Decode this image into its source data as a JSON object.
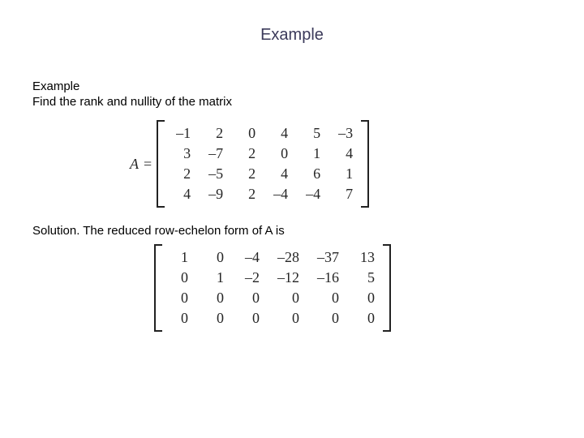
{
  "title": "Example",
  "example_label": "Example",
  "prompt": "Find the rank and nullity of the matrix",
  "matrixA": {
    "lhs": "A",
    "eq": "=",
    "rows": [
      [
        "–1",
        "2",
        "0",
        "4",
        "5",
        "–3"
      ],
      [
        "3",
        "–7",
        "2",
        "0",
        "1",
        "4"
      ],
      [
        "2",
        "–5",
        "2",
        "4",
        "6",
        "1"
      ],
      [
        "4",
        "–9",
        "2",
        "–4",
        "–4",
        "7"
      ]
    ]
  },
  "solution_text": "Solution. The reduced row-echelon form of A is",
  "rref": {
    "rows": [
      [
        "1",
        "0",
        "–4",
        "–28",
        "–37",
        "13"
      ],
      [
        "0",
        "1",
        "–2",
        "–12",
        "–16",
        "5"
      ],
      [
        "0",
        "0",
        "0",
        "0",
        "0",
        "0"
      ],
      [
        "0",
        "0",
        "0",
        "0",
        "0",
        "0"
      ]
    ]
  }
}
